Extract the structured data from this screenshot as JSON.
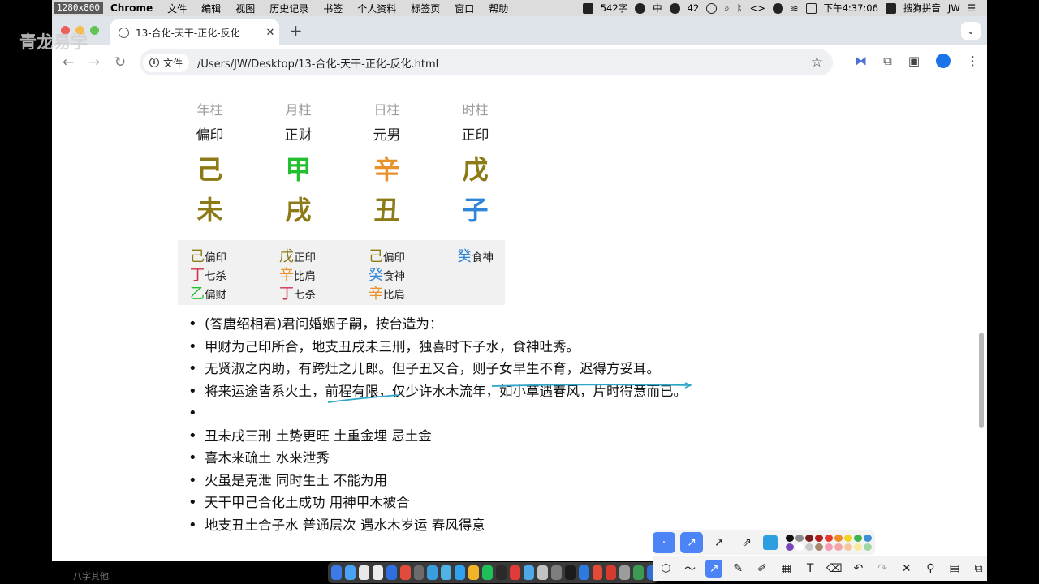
{
  "overlay": {
    "watermark": "青龙易学",
    "resolution_badge": "1280x800",
    "bottom_label": "八字其他"
  },
  "menubar": {
    "app": "Chrome",
    "items": [
      "文件",
      "编辑",
      "视图",
      "历史记录",
      "书签",
      "个人资料",
      "标签页",
      "窗口",
      "帮助"
    ],
    "word_count": "542字",
    "input_method": "中",
    "wechat_badge": "42",
    "time": "下午4:37:06",
    "ime_name": "搜狗拼音",
    "user": "JW"
  },
  "browser": {
    "tab_title": "13-合化-天干-正化-反化",
    "address_chip": "文件",
    "url": "/Users/JW/Desktop/13-合化-天干-正化-反化.html"
  },
  "chart": {
    "pillars": [
      {
        "name": "年柱",
        "shishen": "偏印",
        "stem": "己",
        "stem_color": "#8b7a16",
        "branch": "未",
        "branch_color": "#8b7a16"
      },
      {
        "name": "月柱",
        "shishen": "正财",
        "stem": "甲",
        "stem_color": "#22c02e",
        "branch": "戌",
        "branch_color": "#8b7a16"
      },
      {
        "name": "日柱",
        "shishen": "元男",
        "stem": "辛",
        "stem_color": "#e8922b",
        "branch": "丑",
        "branch_color": "#8b7a16"
      },
      {
        "name": "时柱",
        "shishen": "正印",
        "stem": "戊",
        "stem_color": "#8b7a16",
        "branch": "子",
        "branch_color": "#2f86d8"
      }
    ],
    "hidden_stems": [
      [
        {
          "g": "己",
          "c": "#8b7a16",
          "s": "偏印"
        },
        {
          "g": "丁",
          "c": "#d0304a",
          "s": "七杀"
        },
        {
          "g": "乙",
          "c": "#22c02e",
          "s": "偏财"
        }
      ],
      [
        {
          "g": "戊",
          "c": "#8b7a16",
          "s": "正印"
        },
        {
          "g": "辛",
          "c": "#e8922b",
          "s": "比肩"
        },
        {
          "g": "丁",
          "c": "#d0304a",
          "s": "七杀"
        }
      ],
      [
        {
          "g": "己",
          "c": "#8b7a16",
          "s": "偏印"
        },
        {
          "g": "癸",
          "c": "#2f86d8",
          "s": "食神"
        },
        {
          "g": "辛",
          "c": "#e8922b",
          "s": "比肩"
        }
      ],
      [
        {
          "g": "癸",
          "c": "#2f86d8",
          "s": "食神"
        }
      ]
    ]
  },
  "notes": [
    "(答唐绍相君)君问婚姻子嗣，按台造为：",
    "甲财为己印所合，地支丑戌未三刑，独喜时下子水，食神吐秀。",
    "无贤淑之内助，有跨灶之儿郎。但子丑又合，则子女早生不育，迟得方妥耳。",
    "将来运途皆系火土，前程有限，仅少许水木流年，如小草遇春风，片时得意而已。",
    "",
    "丑未戌三刑 土势更旺  土重金埋  忌土金",
    "喜木来疏土 水来泄秀",
    "火虽是克泄  同时生土  不能为用",
    "天干甲己合化土成功   用神甲木被合",
    "地支丑土合子水   普通层次   遇水木岁运   春风得意"
  ],
  "palette": {
    "swatches": [
      "#111111",
      "#8a8a8a",
      "#7a1c1c",
      "#b01e1e",
      "#e23b2e",
      "#f08a24",
      "#f4d21f",
      "#3fb34f",
      "#3d8fd6",
      "#7a45b8",
      "#ffffff",
      "#c8c8c8",
      "#a7876a",
      "#f19bb4",
      "#f5a3a3",
      "#f7c79b",
      "#f9ea9a",
      "#9fd7a3",
      "#9fc6ee",
      "#c9a8e6"
    ]
  },
  "dock_colors": [
    "#3b7be8",
    "#4aa3f2",
    "#e8e8e8",
    "#ededed",
    "#2f6fde",
    "#e24b3b",
    "#6b6b6b",
    "#3a9de0",
    "#4fb3e6",
    "#2ea0ee",
    "#f0b429",
    "#1fbf5a",
    "#2a2a2a",
    "#e03a3a",
    "#4fa8e8",
    "#c2c2c2",
    "#7d7d7d",
    "#1b1b1b",
    "#2d7be0",
    "#e44a38",
    "#d43b2c",
    "#9c9c9c",
    "#3c9a52",
    "#2f6fd6"
  ]
}
